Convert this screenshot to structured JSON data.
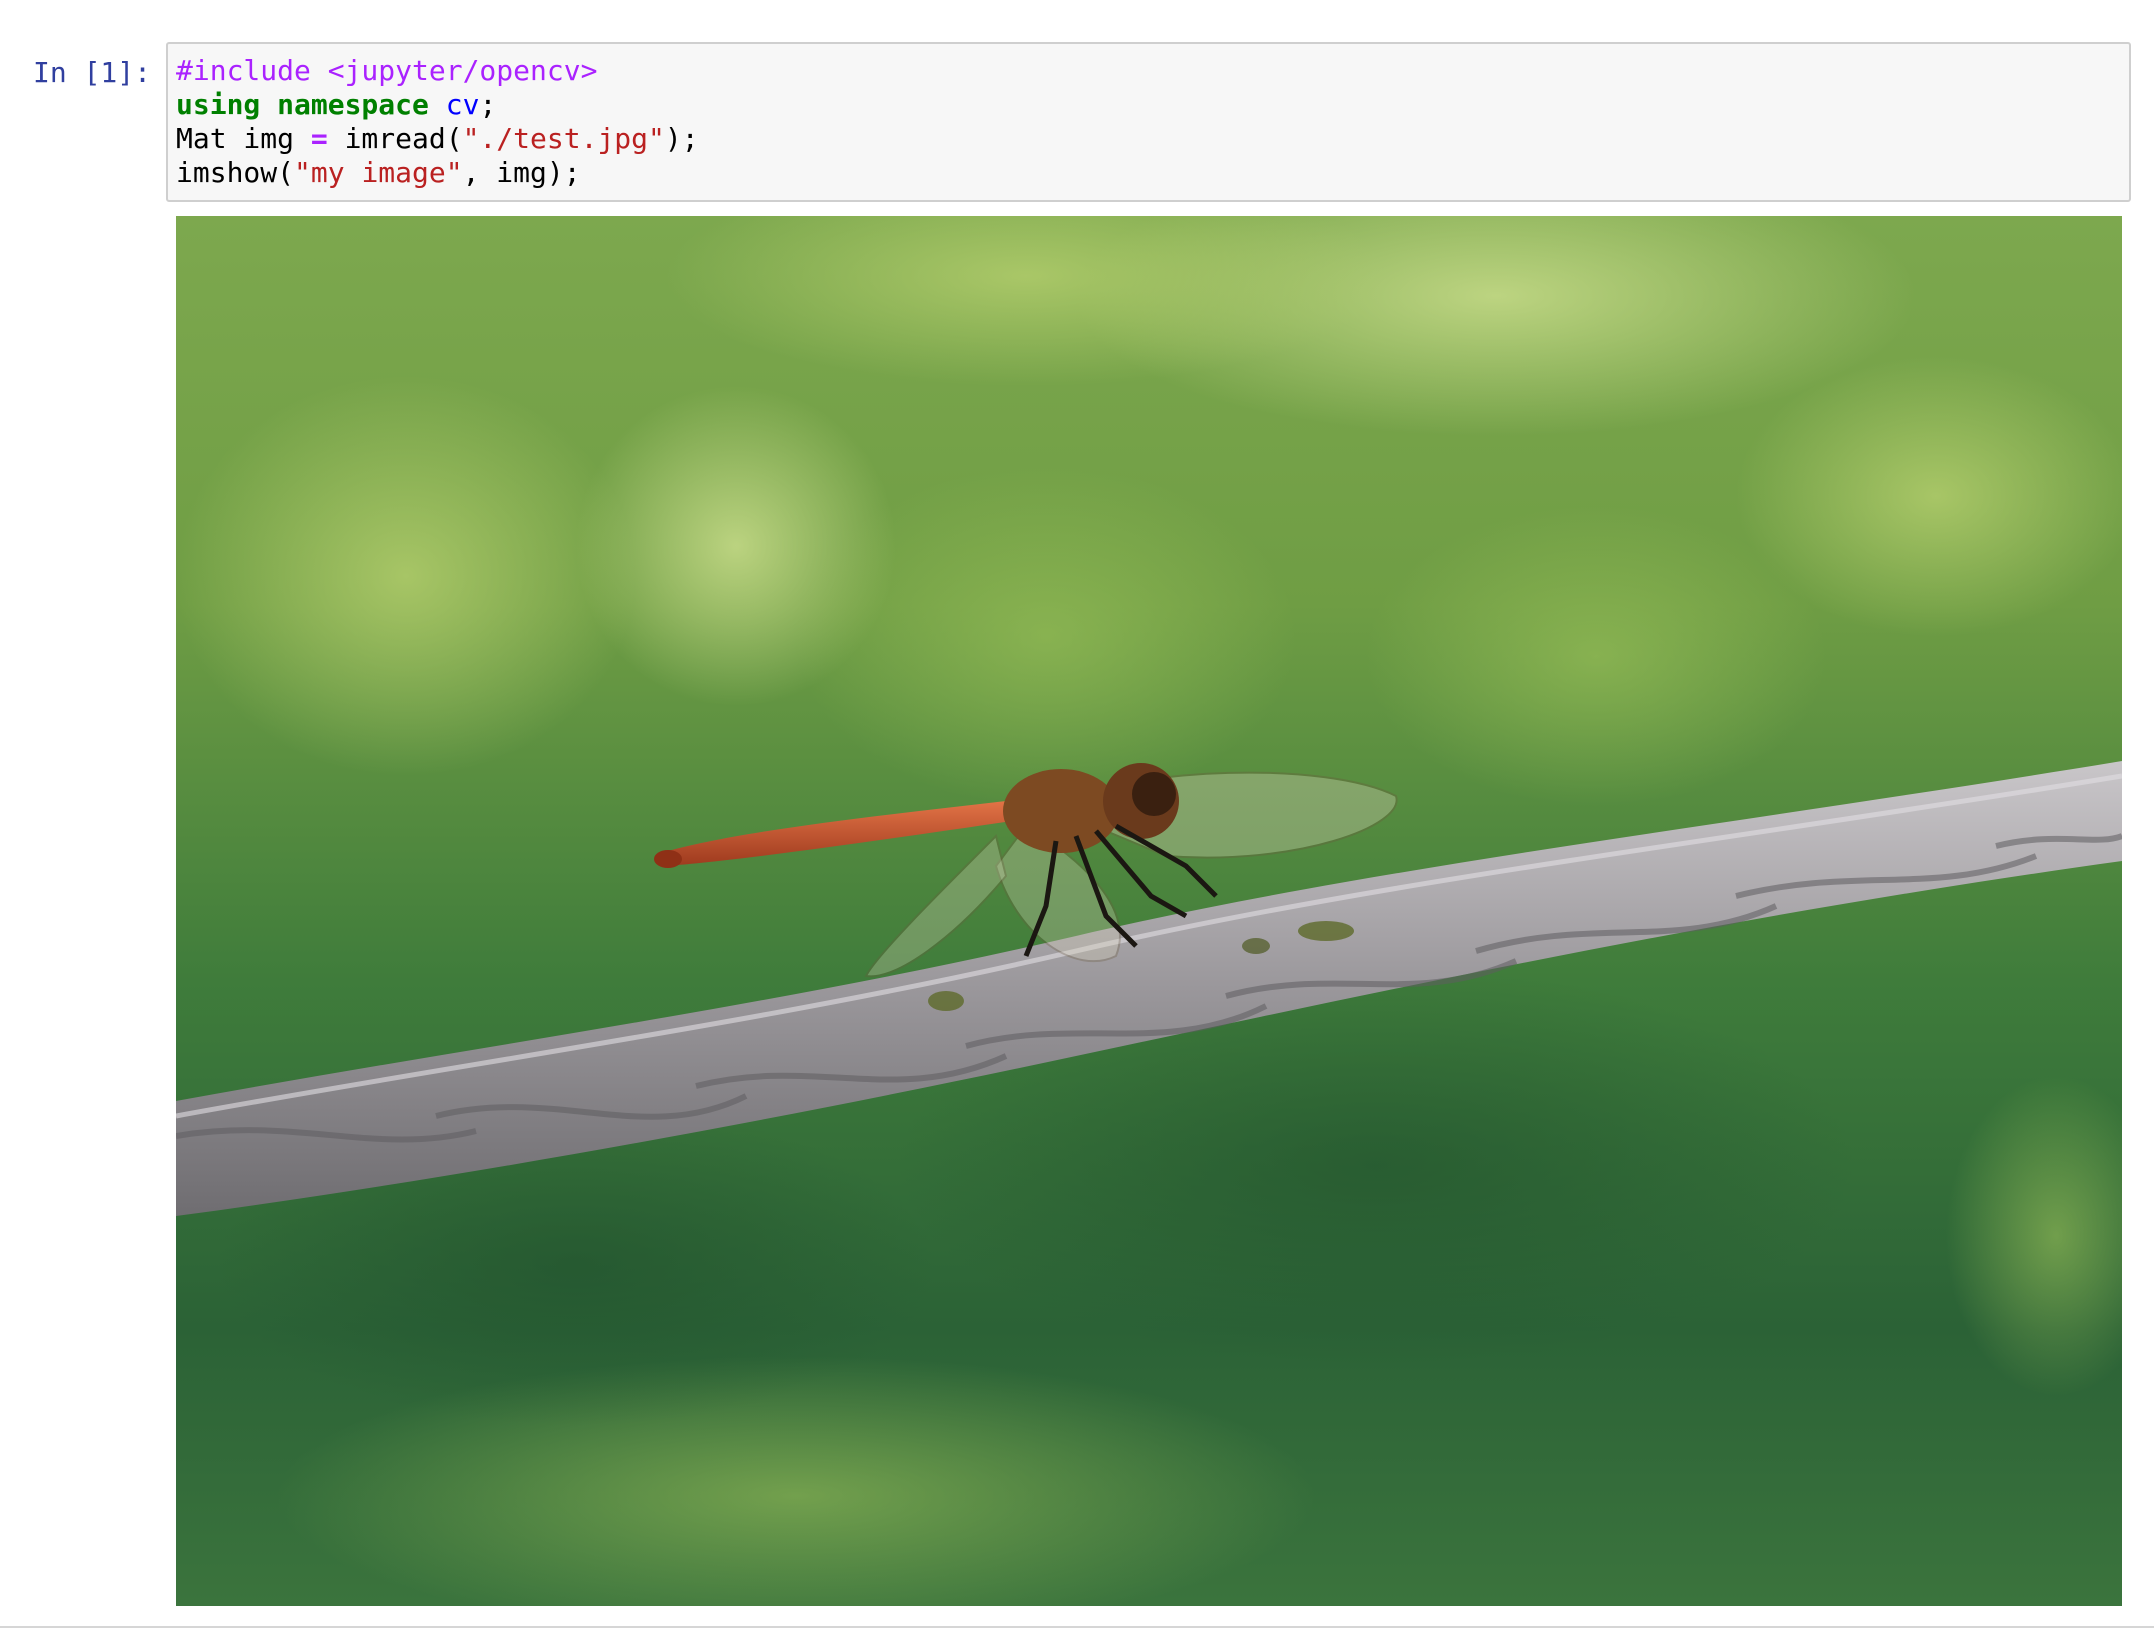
{
  "cell": {
    "prompt": "In [1]:",
    "code_lines": [
      [
        {
          "text": "#include <jupyter/opencv>",
          "kind": "meta"
        }
      ],
      [
        {
          "text": "using namespace",
          "kind": "kw"
        },
        {
          "text": " ",
          "kind": "plain"
        },
        {
          "text": "cv",
          "kind": "ns"
        },
        {
          "text": ";",
          "kind": "plain"
        }
      ],
      [
        {
          "text": "Mat img ",
          "kind": "plain"
        },
        {
          "text": "=",
          "kind": "op"
        },
        {
          "text": " imread(",
          "kind": "plain"
        },
        {
          "text": "\"./test.jpg\"",
          "kind": "str"
        },
        {
          "text": ");",
          "kind": "plain"
        }
      ],
      [
        {
          "text": "imshow(",
          "kind": "plain"
        },
        {
          "text": "\"my image\"",
          "kind": "str"
        },
        {
          "text": ", img);",
          "kind": "plain"
        }
      ]
    ]
  },
  "output": {
    "image_subject": "dragonfly-on-rope-photo",
    "colors": {
      "background_dark": "#2f6a34",
      "background_light": "#a6c766",
      "rope": "#9e9c9e",
      "dragonfly_body": "#c4532c"
    }
  },
  "syntax_colors": {
    "meta": "#aa22ff",
    "keyword": "#008000",
    "namespace": "#0000ff",
    "string": "#ba2121",
    "prompt": "#303f9f"
  }
}
